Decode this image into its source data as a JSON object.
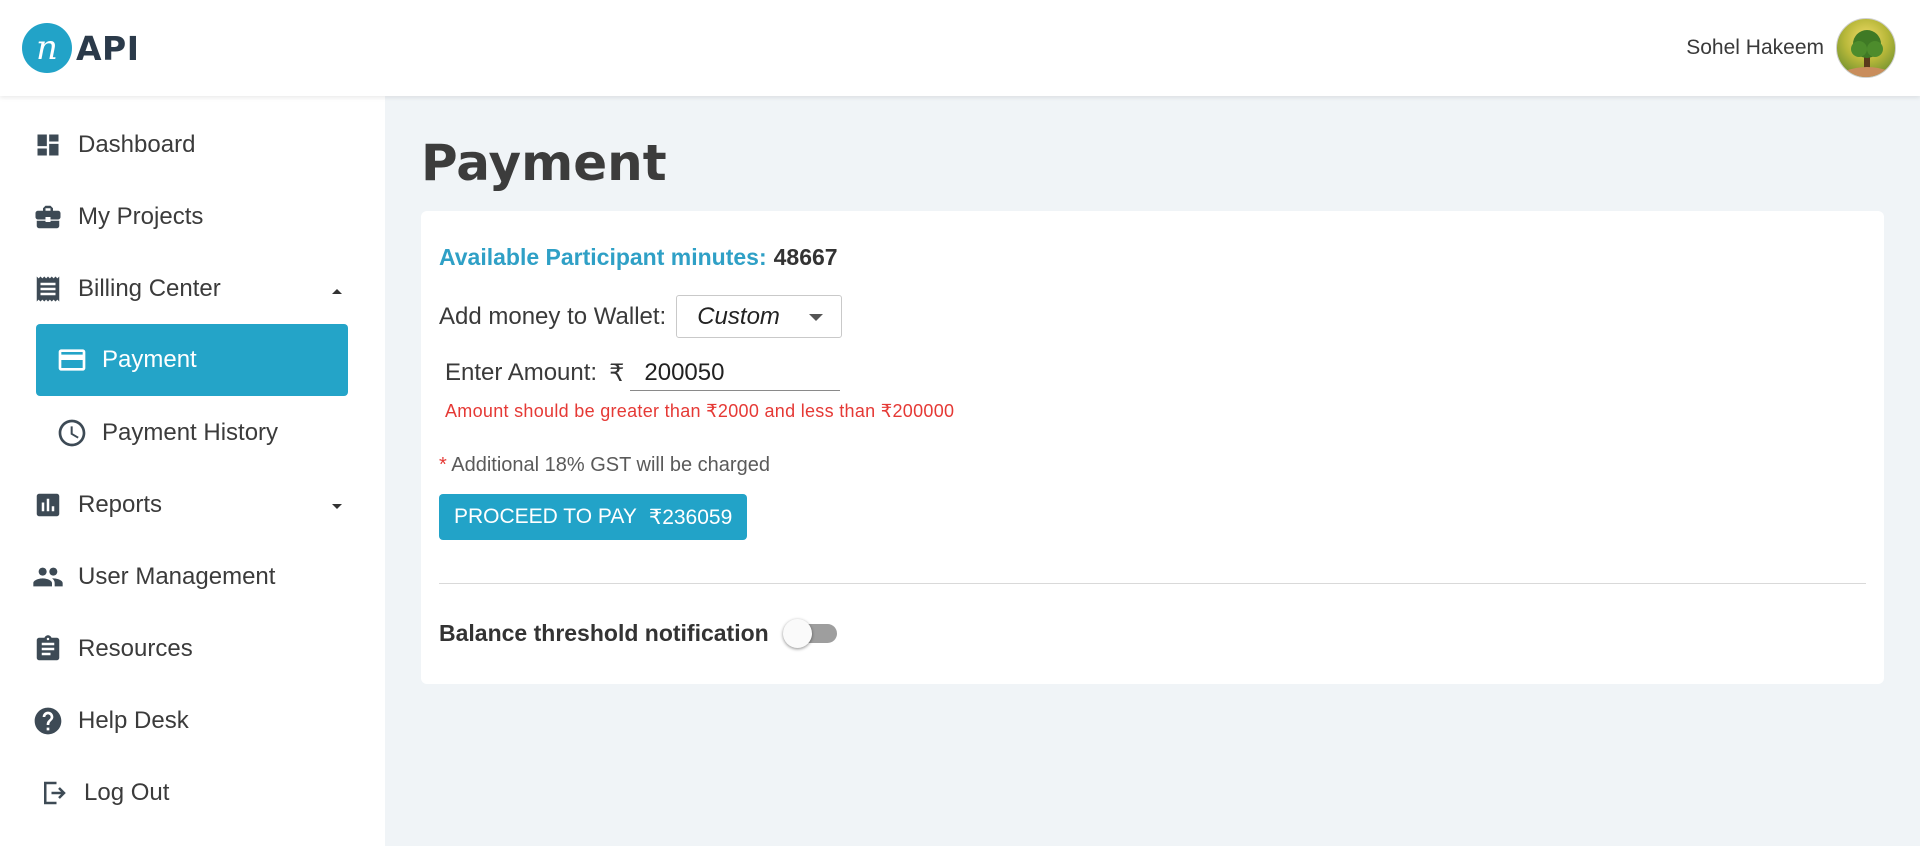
{
  "app": {
    "logo_letter": "n",
    "logo_text": "API"
  },
  "user": {
    "name": "Sohel Hakeem"
  },
  "sidebar": {
    "items": [
      {
        "label": "Dashboard",
        "icon": "dashboard-icon"
      },
      {
        "label": "My Projects",
        "icon": "briefcase-icon"
      },
      {
        "label": "Billing Center",
        "icon": "receipt-icon",
        "expanded": true
      },
      {
        "label": "Payment",
        "icon": "credit-card-icon",
        "active": true
      },
      {
        "label": "Payment History",
        "icon": "clock-icon"
      },
      {
        "label": "Reports",
        "icon": "bar-chart-icon",
        "expanded": false
      },
      {
        "label": "User Management",
        "icon": "people-icon"
      },
      {
        "label": "Resources",
        "icon": "clipboard-icon"
      },
      {
        "label": "Help Desk",
        "icon": "help-icon"
      },
      {
        "label": "Log Out",
        "icon": "logout-icon"
      }
    ]
  },
  "main": {
    "title": "Payment",
    "available_label": "Available Participant minutes:",
    "available_value": "48667",
    "wallet_label": "Add money to Wallet:",
    "wallet_select": "Custom",
    "amount_label": "Enter Amount:",
    "currency": "₹",
    "amount_value": "200050",
    "error_text": "Amount should be greater than ₹2000 and less than ₹200000",
    "gst_star": "*",
    "gst_text": "Additional 18% GST will be charged",
    "pay_button_label": "PROCEED TO PAY",
    "pay_button_amount": "₹236059",
    "threshold_label": "Balance threshold notification",
    "threshold_on": false
  },
  "colors": {
    "accent": "#22a3c8",
    "error": "#e53935",
    "background": "#f0f4f7"
  }
}
